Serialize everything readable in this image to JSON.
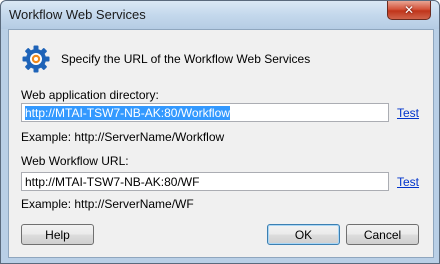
{
  "window": {
    "title": "Workflow Web Services",
    "close_glyph": "✕"
  },
  "header": {
    "icon": "gear-icon",
    "text": "Specify the URL of the Workflow Web Services"
  },
  "web_app_dir": {
    "label": "Web application directory:",
    "value": "http://MTAI-TSW7-NB-AK:80/Workflow",
    "test_label": "Test",
    "example": "Example: http://ServerName/Workflow"
  },
  "web_workflow_url": {
    "label": "Web Workflow URL:",
    "value": "http://MTAI-TSW7-NB-AK:80/WF",
    "test_label": "Test",
    "example": "Example: http://ServerName/WF"
  },
  "buttons": {
    "help": "Help",
    "ok": "OK",
    "cancel": "Cancel"
  },
  "colors": {
    "selection": "#3399ff",
    "link": "#0033cc",
    "gear_blue": "#1e63b8",
    "gear_orange": "#f08a1c"
  }
}
